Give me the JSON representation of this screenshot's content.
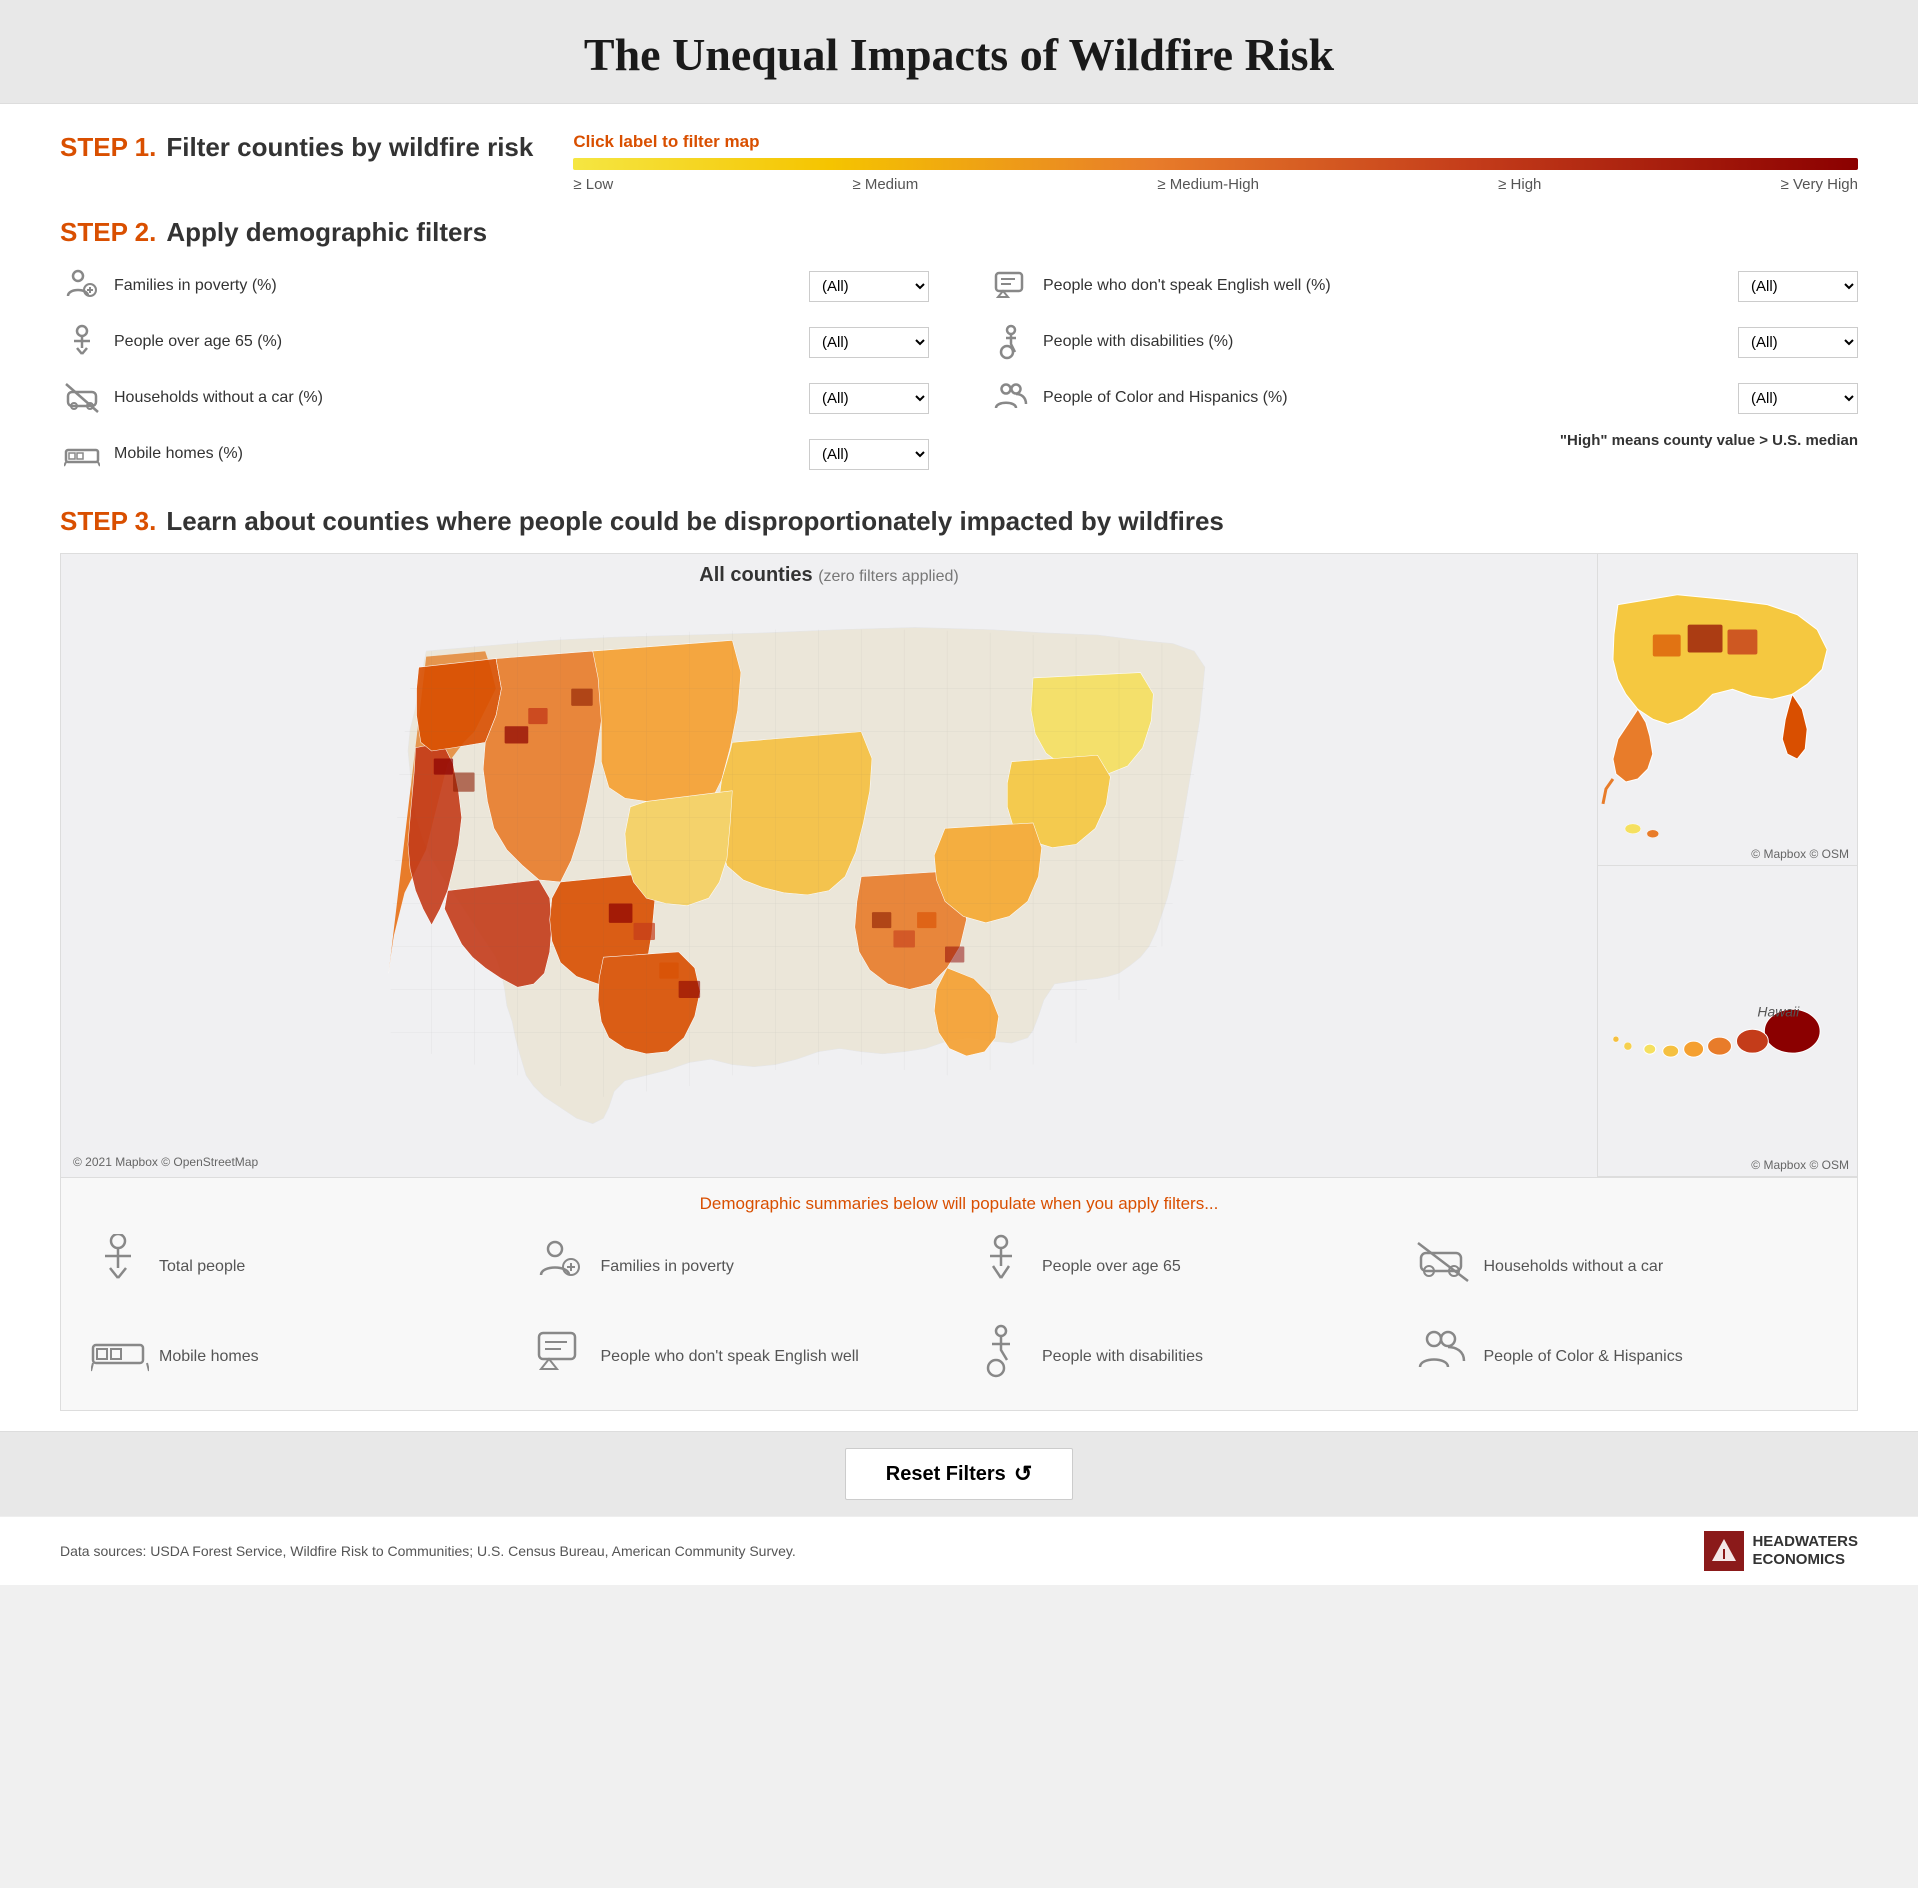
{
  "title": "The Unequal Impacts of Wildfire Risk",
  "step1": {
    "label": "STEP 1.",
    "desc": "Filter counties by wildfire risk",
    "click_label": "Click label to filter map",
    "risk_levels": [
      "≥ Low",
      "≥ Medium",
      "≥ Medium-High",
      "≥ High",
      "≥ Very High"
    ]
  },
  "step2": {
    "label": "STEP 2.",
    "desc": "Apply demographic filters",
    "filters_left": [
      {
        "icon": "💲",
        "name": "Families in poverty (%)",
        "value": "(All)"
      },
      {
        "icon": "🚶",
        "name": "People over age 65 (%)",
        "value": "(All)"
      },
      {
        "icon": "🚗",
        "name": "Households without a car (%)",
        "value": "(All)"
      },
      {
        "icon": "🏠",
        "name": "Mobile homes (%)",
        "value": "(All)"
      }
    ],
    "filters_right": [
      {
        "icon": "💬",
        "name": "People who don't speak English well (%)",
        "value": "(All)"
      },
      {
        "icon": "♿",
        "name": "People with disabilities (%)",
        "value": "(All)"
      },
      {
        "icon": "👥",
        "name": "People of Color and Hispanics (%)",
        "value": "(All)"
      }
    ],
    "median_note": "\"High\" means county value > U.S. median"
  },
  "step3": {
    "label": "STEP 3.",
    "desc": "Learn about counties where people could be disproportionately impacted by wildfires"
  },
  "map": {
    "title": "All counties",
    "subtitle": "(zero filters applied)",
    "copyright": "© 2021 Mapbox  © OpenStreetMap",
    "copyright_inset": "© Mapbox  © OSM",
    "hawaii_label": "Hawaii"
  },
  "demographics": {
    "message": "Demographic summaries below will populate when you apply filters...",
    "items": [
      {
        "icon": "🧍",
        "label": "Total people"
      },
      {
        "icon": "💲",
        "label": "Families in poverty"
      },
      {
        "icon": "🚶",
        "label": "People over age 65"
      },
      {
        "icon": "🚗",
        "label": "Households without a car"
      },
      {
        "icon": "🏠",
        "label": "Mobile homes"
      },
      {
        "icon": "💬",
        "label": "People who don't speak English well"
      },
      {
        "icon": "♿",
        "label": "People with disabilities"
      },
      {
        "icon": "👥",
        "label": "People of Color & Hispanics"
      }
    ]
  },
  "reset": {
    "label": "Reset Filters"
  },
  "footer": {
    "sources": "Data sources: USDA Forest Service, Wildfire Risk to Communities; U.S. Census Bureau, American Community Survey.",
    "logo_line1": "HEADWATERS",
    "logo_line2": "ECONOMICS"
  }
}
